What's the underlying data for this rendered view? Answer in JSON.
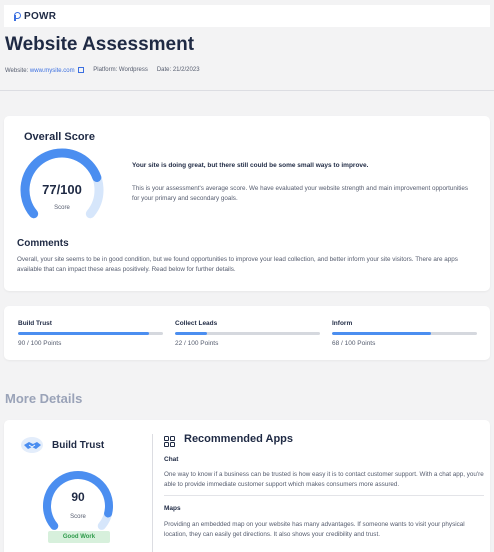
{
  "brand": {
    "name": "POWR"
  },
  "page": {
    "title": "Website Assessment"
  },
  "meta": {
    "website_label": "Website:",
    "website_url": "www.mysite.com",
    "platform": "Platform: Wordpress",
    "date": "Date: 21/2/2023"
  },
  "overall": {
    "title": "Overall Score",
    "score_text": "77/100",
    "score_value": 77,
    "score_max": 100,
    "score_label": "Score",
    "headline": "Your site is doing great, but there still could be some small ways to improve.",
    "description": "This is your assessment's average score. We have evaluated your website strength and main improvement opportunities for your primary and secondary goals."
  },
  "comments": {
    "title": "Comments",
    "text": "Overall, your site seems to be in good condition, but we found opportunities to improve your lead collection, and better inform your site visitors. There are apps available that can impact these areas positively. Read below for further details."
  },
  "metrics": [
    {
      "name": "Build Trust",
      "points": "90 / 100 Points",
      "value": 90
    },
    {
      "name": "Collect Leads",
      "points": "22 / 100 Points",
      "value": 22
    },
    {
      "name": "Inform",
      "points": "68 / 100 Points",
      "value": 68
    }
  ],
  "more_details": {
    "title": "More Details"
  },
  "build_trust": {
    "title": "Build Trust",
    "score": "90",
    "score_value": 90,
    "score_label": "Score",
    "badge": "Good Work"
  },
  "recommended": {
    "title": "Recommended Apps",
    "apps": [
      {
        "name": "Chat",
        "description": "One way to know if a business can be trusted is how easy it is to contact customer support. With a chat app, you're able to provide immediate customer support which makes consumers more assured."
      },
      {
        "name": "Maps",
        "description": "Providing an embedded map on your website has many advantages. If someone wants to visit your physical location, they can easily get directions. It also shows your credibility and trust."
      }
    ]
  },
  "colors": {
    "accent": "#4b8ef0",
    "gauge_track": "#d6e6fb",
    "badge_bg": "#d7f0dc",
    "badge_text": "#2e9a4a"
  },
  "icons": [
    "external-link-icon",
    "handshake-icon",
    "apps-grid-icon",
    "powr-logo-icon"
  ]
}
